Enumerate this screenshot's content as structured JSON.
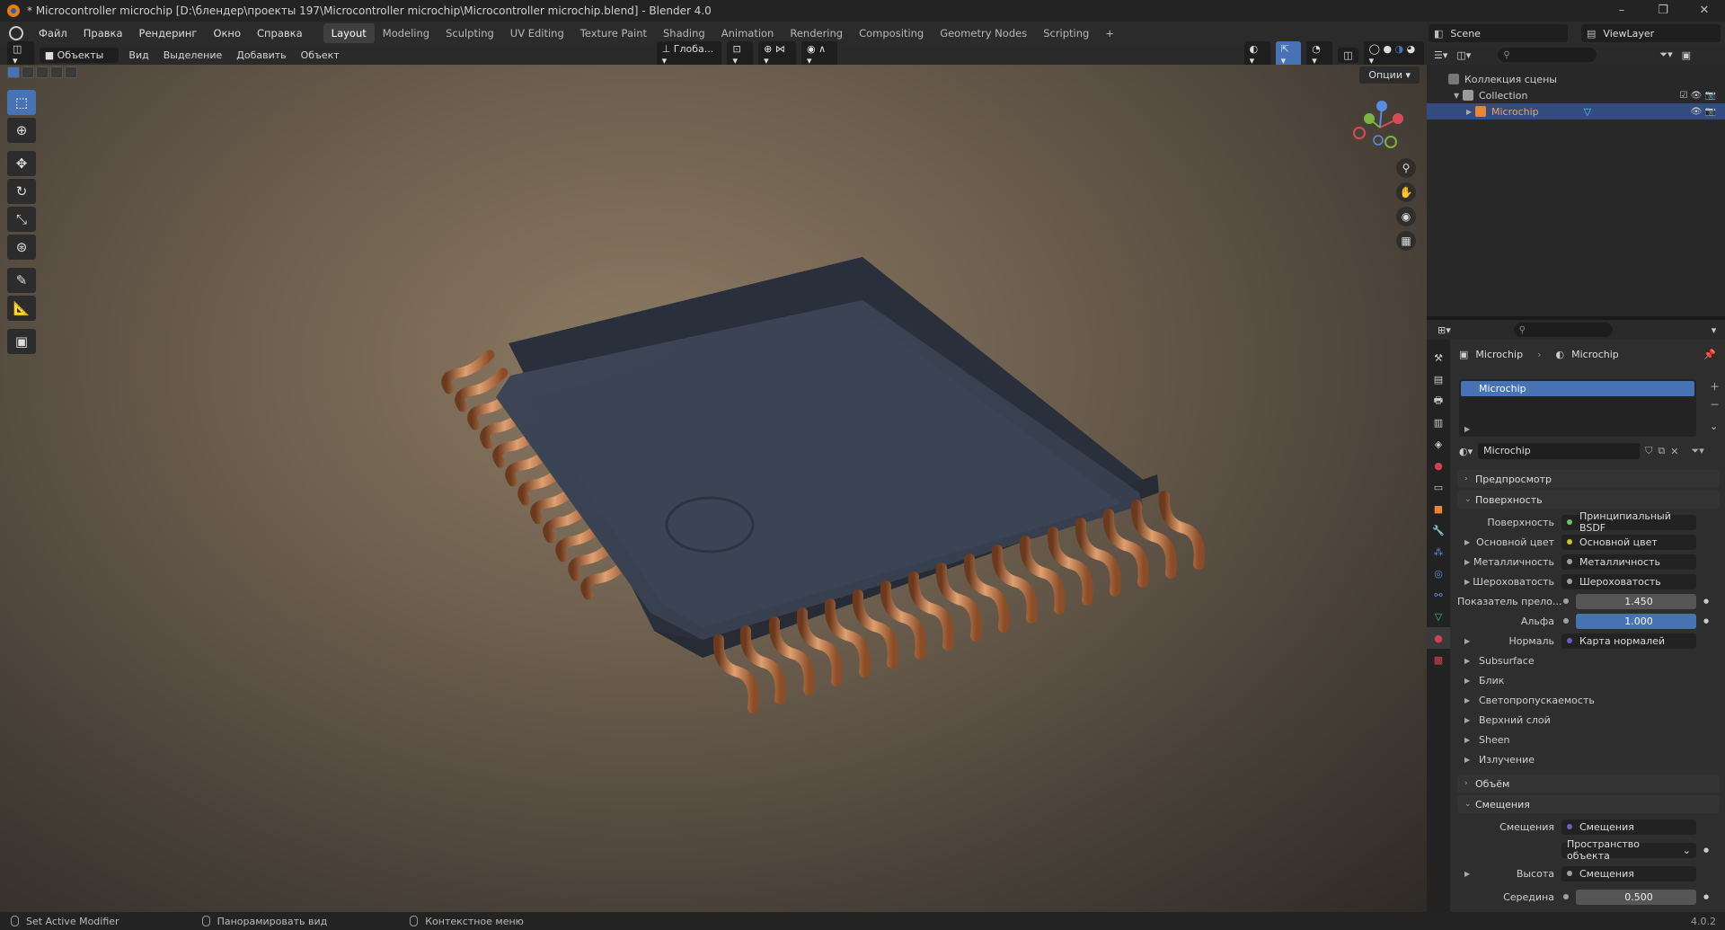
{
  "window": {
    "title": "* Microcontroller microchip [D:\\блендер\\проекты 197\\Microcontroller microchip\\Microcontroller microchip.blend] - Blender 4.0",
    "controls": [
      "–",
      "❐",
      "✕"
    ]
  },
  "menu": {
    "items": [
      "Файл",
      "Правка",
      "Рендеринг",
      "Окно",
      "Справка"
    ],
    "workspaces": [
      "Layout",
      "Modeling",
      "Sculpting",
      "UV Editing",
      "Texture Paint",
      "Shading",
      "Animation",
      "Rendering",
      "Compositing",
      "Geometry Nodes",
      "Scripting",
      "+"
    ],
    "active_workspace": "Layout",
    "scene": "Scene",
    "view_layer": "ViewLayer"
  },
  "viewport_header": {
    "mode": "Объекты",
    "menus": [
      "Вид",
      "Выделение",
      "Добавить",
      "Объект"
    ],
    "orientation": "Глоба...",
    "options": "Опции"
  },
  "outliner": {
    "scene_collection": "Коллекция сцены",
    "collection": "Collection",
    "object": "Microchip"
  },
  "properties": {
    "breadcrumb_object": "Microchip",
    "breadcrumb_material": "Microchip",
    "slot": "Microchip",
    "material_name": "Microchip",
    "panel_preview": "Предпросмотр",
    "panel_surface": "Поверхность",
    "surface_label": "Поверхность",
    "surface_value": "Принципиальный BSDF",
    "rows": [
      {
        "label": "Основной цвет",
        "value": "Основной цвет"
      },
      {
        "label": "Металличность",
        "value": "Металличность"
      },
      {
        "label": "Шероховатость",
        "value": "Шероховатость"
      }
    ],
    "ior_label": "Показатель прело...",
    "ior_value": "1.450",
    "alpha_label": "Альфа",
    "alpha_value": "1.000",
    "normal_label": "Нормаль",
    "normal_value": "Карта нормалей",
    "subpanels": [
      "Subsurface",
      "Блик",
      "Светопропускаемость",
      "Верхний слой",
      "Sheen",
      "Излучение"
    ],
    "panel_volume": "Объём",
    "panel_displacement": "Смещения",
    "disp_label": "Смещения",
    "disp_value": "Смещения",
    "space_value": "Пространство объекта",
    "height_label": "Высота",
    "height_value": "Смещения",
    "midlevel_label": "Середина",
    "midlevel_value": "0.500"
  },
  "status": {
    "left": "Set Active Modifier",
    "middle": "Панорамировать вид",
    "right": "Контекстное меню",
    "version": "4.0.2"
  },
  "colors": {
    "accent": "#4772b3",
    "chip_body": "#3b4454",
    "pins": "#b8703f",
    "selected_row": "#334d80"
  }
}
